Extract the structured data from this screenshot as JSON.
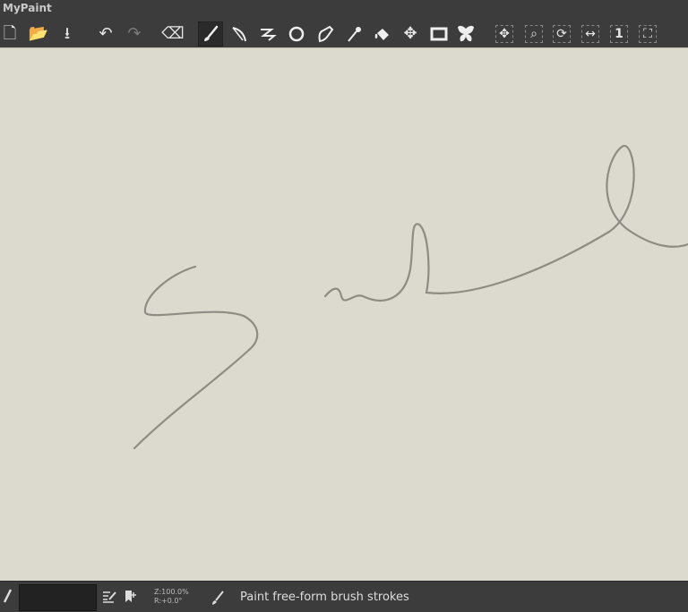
{
  "app": {
    "title": "MyPaint"
  },
  "toolbar": {
    "items": [
      {
        "name": "new-document",
        "glyph": "🗋"
      },
      {
        "name": "open-document",
        "glyph": "📂"
      },
      {
        "name": "save-document",
        "glyph": "⭳"
      },
      {
        "name": "undo",
        "glyph": "↶"
      },
      {
        "name": "redo",
        "glyph": "↷"
      },
      {
        "name": "eraser-mode",
        "glyph": "⌫"
      },
      {
        "name": "freehand-brush",
        "glyph": "🖌"
      },
      {
        "name": "lines-curves",
        "glyph": "⟋"
      },
      {
        "name": "connected-lines",
        "glyph": "≈"
      },
      {
        "name": "ellipses",
        "glyph": "○"
      },
      {
        "name": "inking",
        "glyph": "✒"
      },
      {
        "name": "color-picker",
        "glyph": "⁄"
      },
      {
        "name": "flood-fill",
        "glyph": "⛾"
      },
      {
        "name": "move-layer",
        "glyph": "✥"
      },
      {
        "name": "frame-edit",
        "glyph": "▭"
      },
      {
        "name": "symmetry",
        "glyph": "⋈"
      },
      {
        "name": "pan-view",
        "glyph": "✥"
      },
      {
        "name": "zoom-view",
        "glyph": "⌕"
      },
      {
        "name": "rotate-view",
        "glyph": "⟳"
      },
      {
        "name": "mirror-view",
        "glyph": "↔"
      },
      {
        "name": "reset-view",
        "glyph": "1"
      },
      {
        "name": "fit-view",
        "glyph": "⛶"
      }
    ]
  },
  "status": {
    "zoom": "Z:100.0%",
    "rotation": "R:+0.0°",
    "message": "Paint free-form brush strokes"
  },
  "colors": {
    "canvas": "#dcdacf",
    "stroke": "#8e8c84",
    "chrome": "#3c3c3c"
  }
}
